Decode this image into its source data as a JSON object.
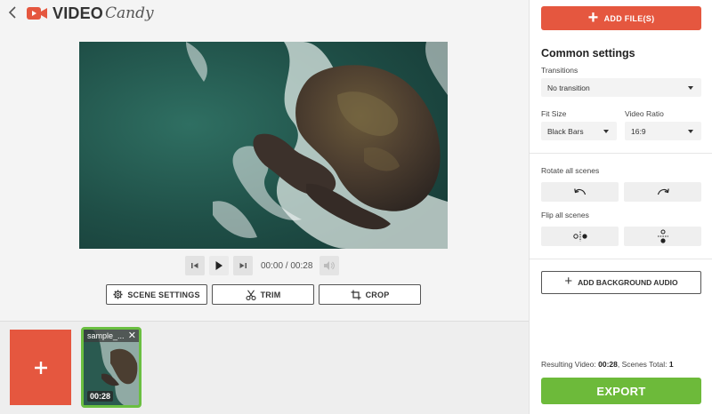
{
  "app": {
    "logo_word1": "VIDEO",
    "logo_word2": "Candy",
    "brand_color": "#e5573f"
  },
  "player": {
    "current_time": "00:00",
    "separator": " / ",
    "total_time": "00:28"
  },
  "toolbar": {
    "scene_settings_label": "SCENE SETTINGS",
    "trim_label": "TRIM",
    "crop_label": "CROP"
  },
  "timeline": {
    "clips": [
      {
        "name": "sample_...",
        "duration": "00:28",
        "selected": true
      }
    ]
  },
  "panel": {
    "add_files_label": "ADD FILE(S)",
    "common_settings_title": "Common settings",
    "transitions_label": "Transitions",
    "transitions_value": "No transition",
    "fit_size_label": "Fit Size",
    "fit_size_value": "Black Bars",
    "video_ratio_label": "Video Ratio",
    "video_ratio_value": "16:9",
    "rotate_label": "Rotate all scenes",
    "flip_label": "Flip all scenes",
    "add_audio_label": "ADD BACKGROUND AUDIO",
    "result_prefix": "Resulting Video: ",
    "result_duration": "00:28",
    "result_mid": ", Scenes Total: ",
    "result_scenes": "1",
    "export_label": "EXPORT",
    "export_color": "#6dba3a"
  }
}
